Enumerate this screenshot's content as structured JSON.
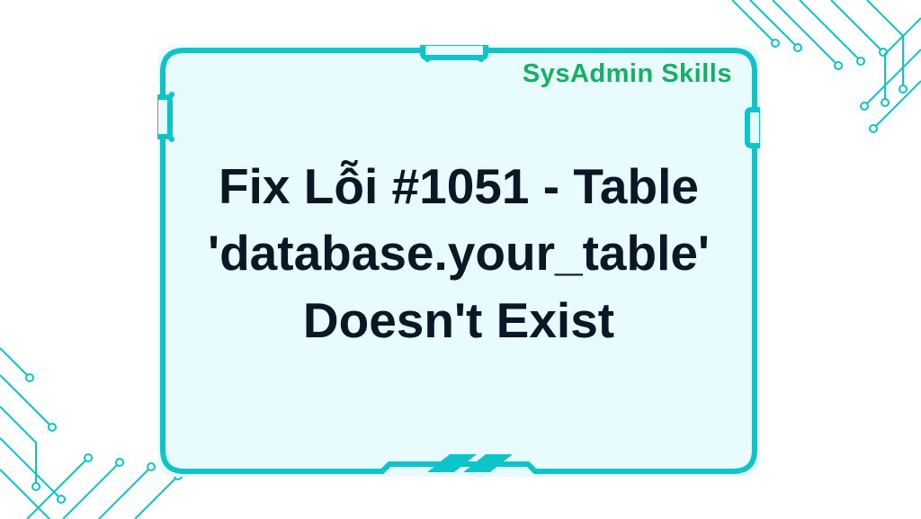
{
  "brand": "SysAdmin Skills",
  "title": "Fix Lỗi #1051 - Table 'database.your_table' Doesn't Exist",
  "colors": {
    "accent": "#0cc4c9",
    "brand_green": "#14b162",
    "panel_bg": "#e8fbff",
    "text": "#0b1726"
  }
}
